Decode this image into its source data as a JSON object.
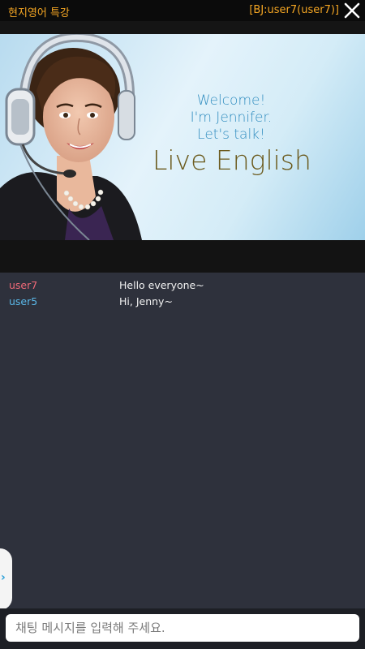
{
  "header": {
    "title": "현지영어 특강",
    "bj_label": "[BJ:user7(user7)]",
    "close_icon": "close-icon"
  },
  "video": {
    "welcome_lines": [
      "Welcome!",
      "I'm Jennifer.",
      "Let's talk!"
    ],
    "headline": "Live English"
  },
  "chat": {
    "messages": [
      {
        "user": "user7",
        "text": "Hello everyone~",
        "user_color": "#f06a78"
      },
      {
        "user": "user5",
        "text": "Hi, Jenny~",
        "user_color": "#5ab7e8"
      }
    ]
  },
  "side_tab": {
    "icon": "chevron-right-icon",
    "glyph": "›"
  },
  "input": {
    "placeholder": "채팅 메시지를 입력해 주세요."
  },
  "colors": {
    "accent": "#f5a623",
    "chat_bg": "#2e313c"
  }
}
